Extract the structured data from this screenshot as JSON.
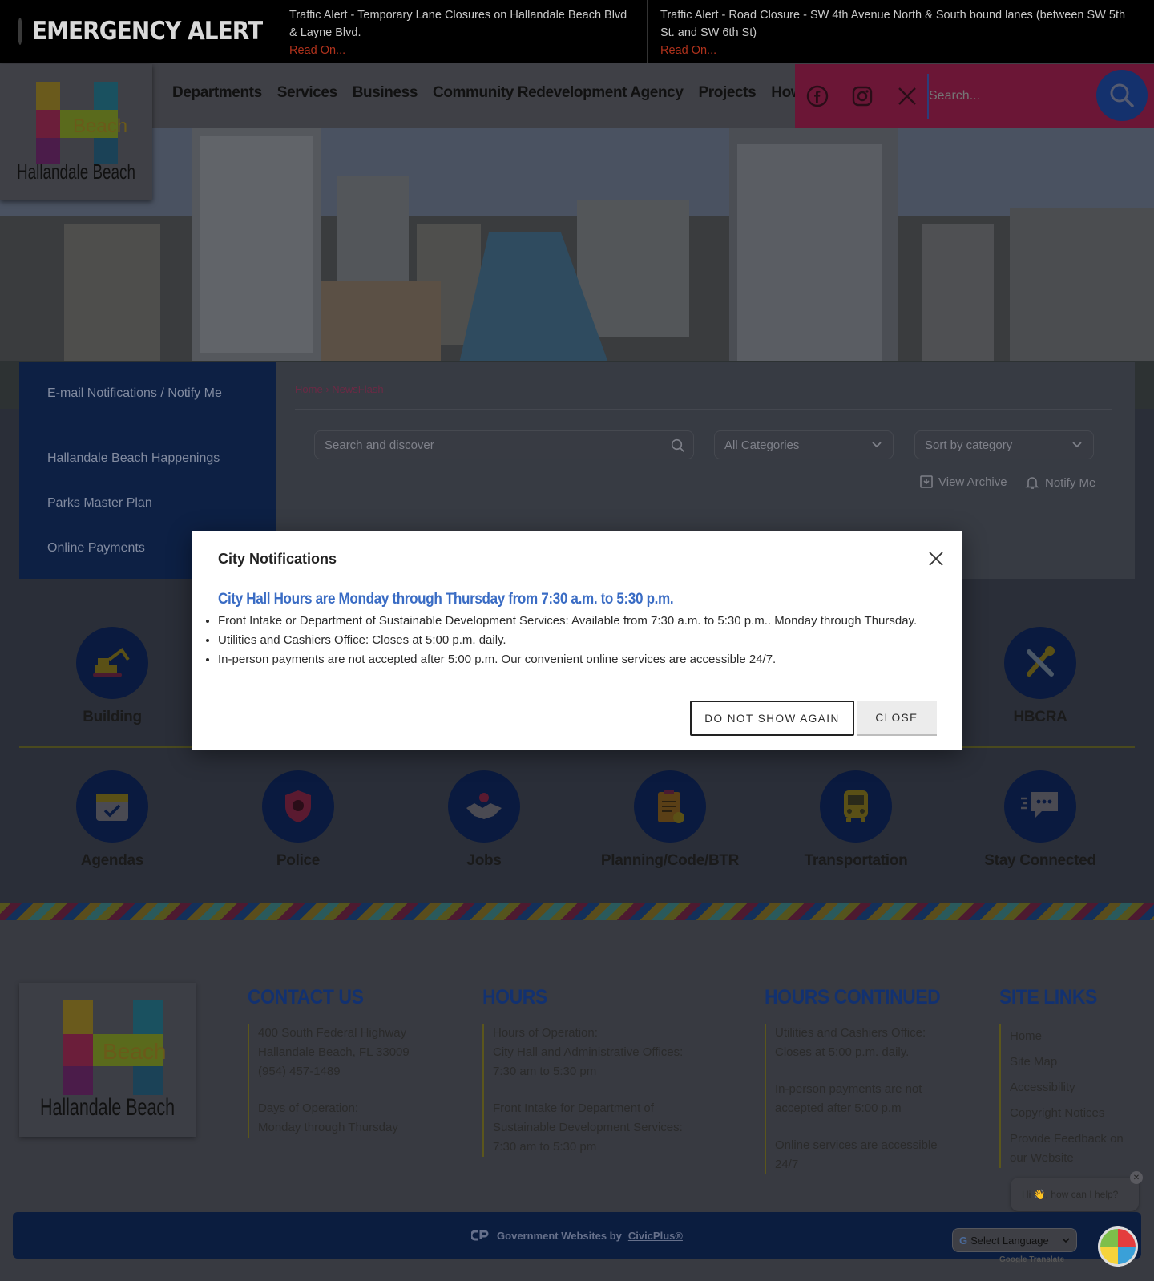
{
  "alert": {
    "title": "EMERGENCY ALERT",
    "items": [
      {
        "text": "Traffic Alert - Temporary Lane Closures on Hallandale Beach Blvd & Layne Blvd.",
        "link": "Read On..."
      },
      {
        "text": "Traffic Alert - Road Closure - SW 4th Avenue North & South bound lanes (between SW 5th St. and SW 6th St)",
        "link": "Read On..."
      }
    ]
  },
  "brand": {
    "logo_word": "Beach",
    "logo_name": "Hallandale Beach"
  },
  "nav": [
    "Departments",
    "Services",
    "Business",
    "Community Redevelopment Agency",
    "Projects",
    "How Do I..."
  ],
  "header": {
    "search_placeholder": "Search..."
  },
  "side_menu": [
    "E-mail Notifications / Notify Me",
    "Hallandale Beach Happenings",
    "Parks Master Plan",
    "Online Payments"
  ],
  "breadcrumb": {
    "home": "Home",
    "current": "NewsFlash"
  },
  "filters": {
    "search_placeholder": "Search and discover",
    "category": "All Categories",
    "sort": "Sort by category",
    "view_archive": "View Archive",
    "notify_me": "Notify Me"
  },
  "icon_tiles_row1": [
    "Building",
    "HBCRA"
  ],
  "icon_tiles_row2": [
    "Agendas",
    "Police",
    "Jobs",
    "Planning/Code/BTR",
    "Transportation",
    "Stay Connected"
  ],
  "modal": {
    "title": "City Notifications",
    "heading": "City Hall Hours are Monday through Thursday from 7:30 a.m. to 5:30 p.m.",
    "items": [
      "Front Intake or Department of Sustainable Development Services: Available from 7:30 a.m. to 5:30 p.m.. Monday through Thursday.",
      "Utilities and Cashiers Office: Closes at 5:00 p.m. daily.",
      "In-person payments are not accepted after 5:00 p.m. Our convenient online services are accessible 24/7."
    ],
    "btn_do_not_show": "DO NOT SHOW AGAIN",
    "btn_close": "CLOSE"
  },
  "footer": {
    "contact": {
      "heading": "CONTACT US",
      "lines": [
        "400 South Federal Highway",
        "Hallandale Beach, FL 33009",
        "(954) 457-1489",
        "",
        "Days of Operation:",
        "Monday through Thursday"
      ]
    },
    "hours": {
      "heading": "HOURS",
      "lines": [
        "Hours of Operation:",
        "City Hall and Administrative Offices:",
        "7:30 am to 5:30 pm",
        "",
        "Front Intake for Department of",
        "Sustainable Development Services:",
        "7:30 am to 5:30 pm"
      ]
    },
    "hours_continued": {
      "heading": "HOURS CONTINUED",
      "lines": [
        "Utilities and Cashiers Office:",
        "Closes at 5:00 p.m. daily.",
        "",
        "In-person payments are not",
        "accepted after 5:00 p.m",
        "",
        " Online services are accessible",
        "24/7"
      ]
    },
    "site_links": {
      "heading": "SITE LINKS",
      "links": [
        "Home",
        "Site Map",
        "Accessibility",
        "Copyright Notices",
        "Provide Feedback on our Website"
      ]
    },
    "civic": {
      "prefix": "Government Websites by",
      "brand": "CivicPlus®"
    },
    "chat_text": "Hi 👋, how can I help?",
    "language_select": "Select Language",
    "translate_label": "Google Translate"
  },
  "colors": {
    "accent_magenta": "#d6195e",
    "navy": "#14316d",
    "link_blue": "#3a6cc4"
  }
}
